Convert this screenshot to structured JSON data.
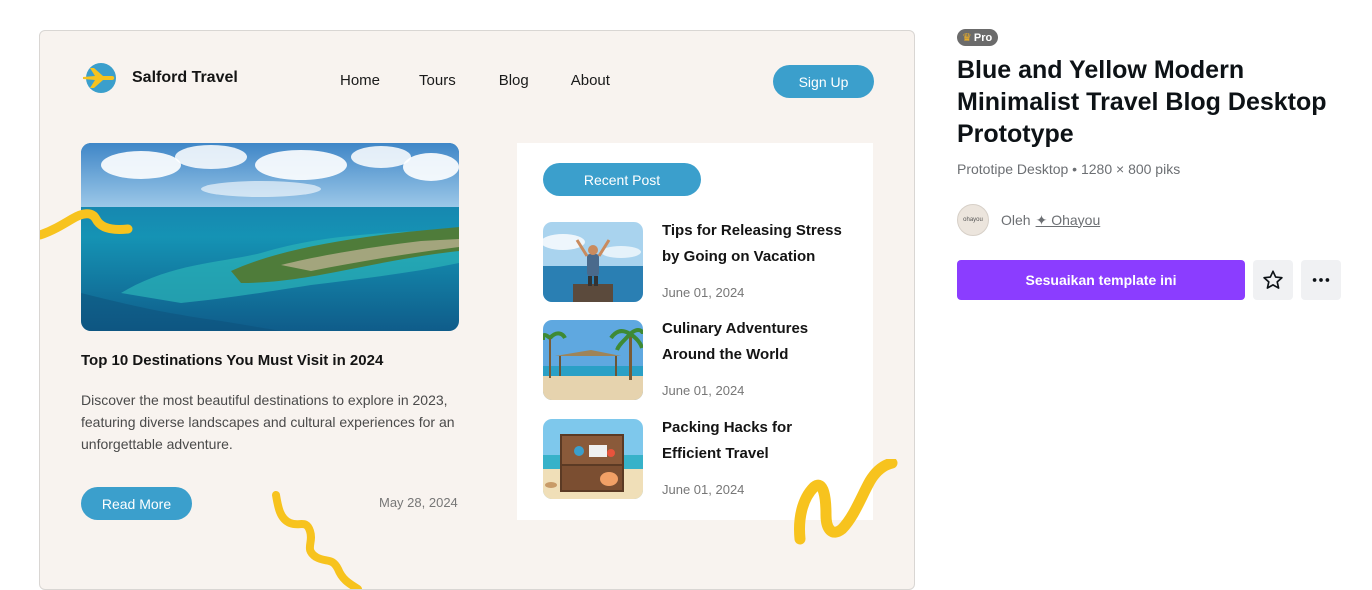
{
  "preview": {
    "brand": {
      "name": "Salford Travel",
      "logo_icon": "airplane-icon"
    },
    "nav": {
      "items": [
        "Home",
        "Tours",
        "Blog",
        "About"
      ]
    },
    "signup_label": "Sign Up",
    "featured": {
      "title": "Top 10 Destinations You Must Visit in 2024",
      "description": "Discover the most beautiful destinations to explore in 2023, featuring diverse landscapes and cultural experiences for an unforgettable adventure.",
      "read_more_label": "Read More",
      "date": "May 28, 2024"
    },
    "recent": {
      "heading": "Recent Post",
      "posts": [
        {
          "title": "Tips for Releasing Stress by Going on Vacation",
          "date": "June 01, 2024"
        },
        {
          "title": "Culinary Adventures Around the World",
          "date": "June 01, 2024"
        },
        {
          "title": "Packing Hacks for Efficient Travel",
          "date": "June 01, 2024"
        }
      ]
    },
    "colors": {
      "accent": "#3b9fcc",
      "squiggle": "#f7c31e",
      "background": "#f8f3ef"
    }
  },
  "panel": {
    "badge": {
      "label": "Pro",
      "icon": "crown-icon"
    },
    "title": "Blue and Yellow Modern Minimalist Travel Blog Desktop Prototype",
    "meta": "Prototipe Desktop • 1280 × 800 piks",
    "author": {
      "prefix": "Oleh",
      "name": "✦ Ohayou",
      "avatar_text": "ohayou"
    },
    "customize_label": "Sesuaikan template ini",
    "favorite_icon": "star-icon",
    "more_icon": "more-icon",
    "colors": {
      "primary": "#8b3dff"
    }
  }
}
